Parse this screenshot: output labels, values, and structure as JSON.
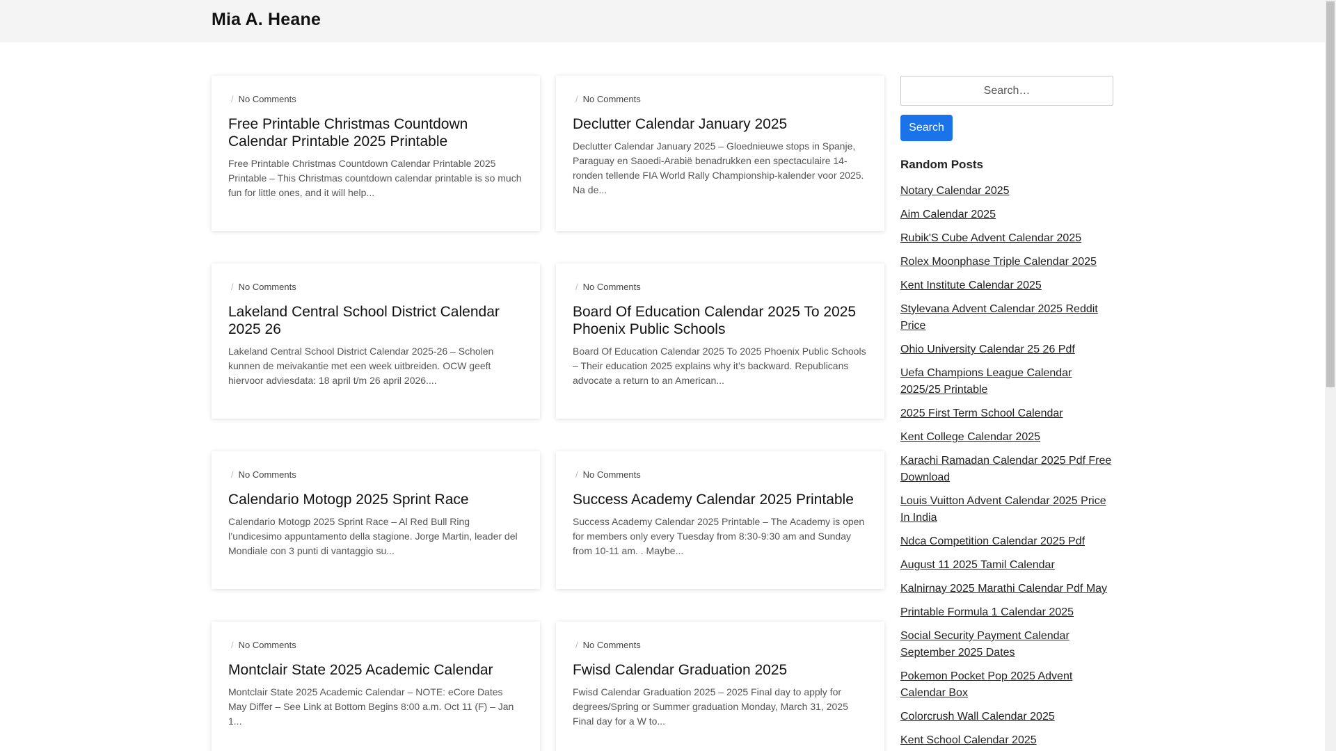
{
  "site": {
    "title": "Mia A. Heane"
  },
  "posts": [
    {
      "meta": "No Comments",
      "title": "Free Printable Christmas Countdown Calendar Printable 2025 Printable",
      "excerpt": "Free Printable Christmas Countdown Calendar Printable 2025 Printable – This Christmas countdown calendar printable is so much fun for little ones, and it will help..."
    },
    {
      "meta": "No Comments",
      "title": "Declutter Calendar January 2025",
      "excerpt": "Declutter Calendar January 2025 – Gloednieuwe stops in Spanje, Paraguay en Saoedi-Arabië benadrukken een spectaculaire 14-ronden tellende FIA World Rally Championship-kalender voor 2025. Na de..."
    },
    {
      "meta": "No Comments",
      "title": "Lakeland Central School District Calendar 2025 26",
      "excerpt": "Lakeland Central School District Calendar 2025-26 – Scholen kunnen de meivakantie met een week uitbreiden. OCW geeft hiervoor adviesdata: 18 april t/m 26 april 2026...."
    },
    {
      "meta": "No Comments",
      "title": "Board Of Education Calendar 2025 To 2025 Phoenix Public Schools",
      "excerpt": "Board Of Education Calendar 2025 To 2025 Phoenix Public Schools – Their education 2025 explains why it’s backward. Republicans advocate a return to an American..."
    },
    {
      "meta": "No Comments",
      "title": "Calendario Motogp 2025 Sprint Race",
      "excerpt": "Calendario Motogp 2025 Sprint Race – Al Red Bull Ring l’undicesimo appuntamento della stagione. Jorge Martin, leader del Mondiale con 3 punti di vantaggio su..."
    },
    {
      "meta": "No Comments",
      "title": "Success Academy Calendar 2025 Printable",
      "excerpt": "Success Academy Calendar 2025 Printable – The Academy is open for members only every Tuesday from 8:30-9:30 am and Sunday from 10-11 am. . Maybe..."
    },
    {
      "meta": "No Comments",
      "title": "Montclair State 2025 Academic Calendar",
      "excerpt": "Montclair State 2025 Academic Calendar – NOTE: eCore Dates May Differ – See Link at Bottom Begins 8:00 a.m. Oct 11 (F) – Jan 1..."
    },
    {
      "meta": "No Comments",
      "title": "Fwisd Calendar Graduation 2025",
      "excerpt": "Fwisd Calendar Graduation 2025 – 2025 Final day to apply for degrees/Spring or Summer graduation Monday, March 31, 2025 Final day for a W to..."
    }
  ],
  "sidebar": {
    "search_placeholder": "Search…",
    "search_button": "Search",
    "random_title": "Random Posts",
    "random_posts": [
      "Notary Calendar 2025",
      "Aim Calendar 2025",
      "Rubik'S Cube Advent Calendar 2025",
      "Rolex Moonphase Triple Calendar 2025",
      "Kent Institute Calendar 2025",
      "Stylevana Advent Calendar 2025 Reddit Price",
      "Ohio University Calendar 25 26 Pdf",
      "Uefa Champions League Calendar 2025/25 Printable",
      "2025 First Term School Calendar",
      "Kent College Calendar 2025",
      "Karachi Ramadan Calendar 2025 Pdf Free Download",
      "Louis Vuitton Advent Calendar 2025 Price In India",
      "Ndca Competition Calendar 2025 Pdf",
      "August 11 2025 Tamil Calendar",
      "Kalnirnay 2025 Marathi Calendar Pdf May",
      "Printable Formula 1 Calendar 2025",
      "Social Security Payment Calendar September 2025 Dates",
      "Pokemon Pocket Pop 2025 Advent Calendar Box",
      "Colorcrush Wall Calendar 2025",
      "Kent School Calendar 2025"
    ]
  }
}
